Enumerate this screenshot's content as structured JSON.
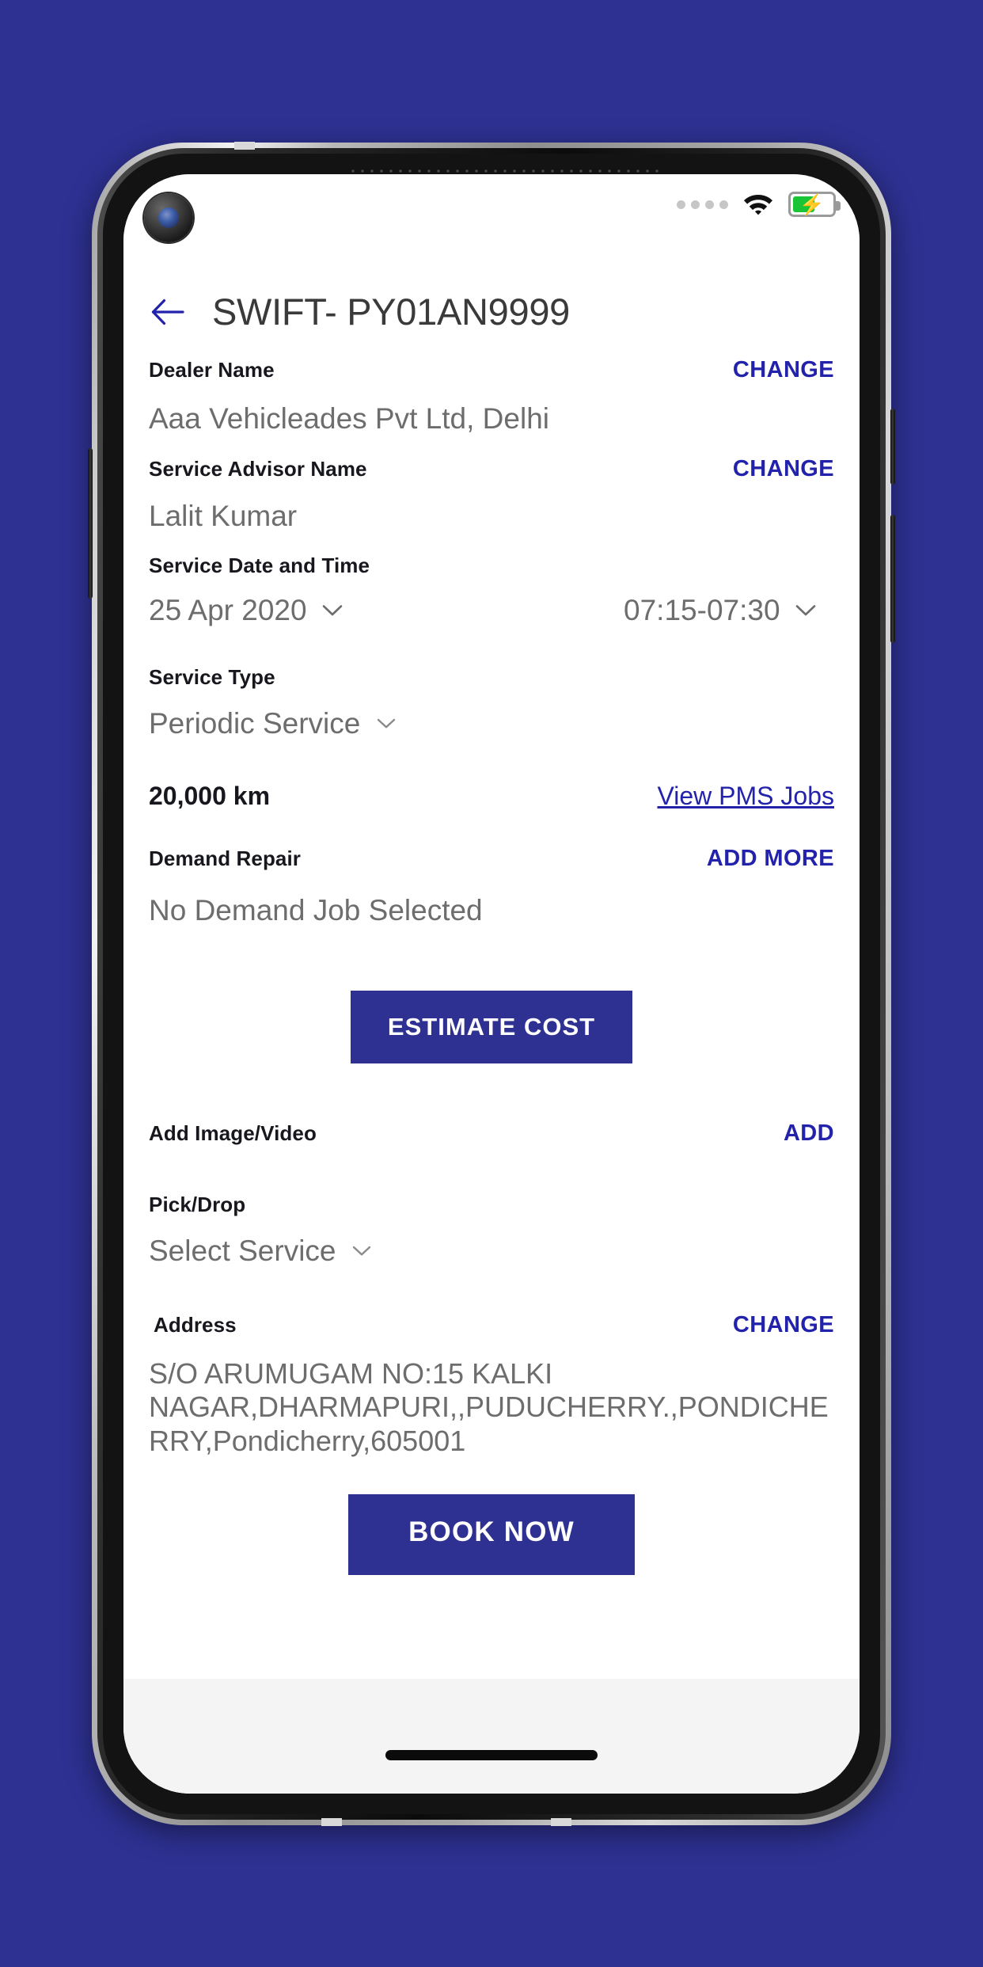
{
  "theme": {
    "page_background": "#2e3192",
    "accent": "#2e3192",
    "link_blue": "#2222aa",
    "label_dark": "#17171e",
    "value_gray": "#6d6d6d",
    "battery_green": "#19c437"
  },
  "status_bar": {
    "signal_icon": "signal-dots-icon",
    "signal_dots": 4,
    "wifi_icon": "wifi-icon",
    "battery_icon": "battery-charging-icon",
    "battery_level_percent": 50,
    "charging": true
  },
  "header": {
    "back_icon": "back-arrow-icon",
    "title": "SWIFT- PY01AN9999"
  },
  "form": {
    "dealer": {
      "label": "Dealer Name",
      "action": "CHANGE",
      "value": "Aaa Vehicleades Pvt Ltd, Delhi"
    },
    "advisor": {
      "label": "Service Advisor Name",
      "action": "CHANGE",
      "value": "Lalit Kumar"
    },
    "service_datetime": {
      "label": "Service Date and Time",
      "date_value": "25 Apr 2020",
      "time_value": "07:15-07:30",
      "date_chevron_icon": "chevron-down-icon",
      "time_chevron_icon": "chevron-down-icon"
    },
    "service_type": {
      "label": "Service Type",
      "value": "Periodic Service",
      "chevron_icon": "chevron-down-icon"
    },
    "mileage": {
      "value": "20,000 km",
      "link": "View PMS Jobs"
    },
    "demand_repair": {
      "label": "Demand Repair",
      "action": "ADD MORE",
      "value": "No Demand Job Selected"
    },
    "estimate_button": "ESTIMATE COST",
    "add_media": {
      "label": "Add Image/Video",
      "action": "ADD"
    },
    "pick_drop": {
      "label": "Pick/Drop",
      "value": "Select Service",
      "chevron_icon": "chevron-down-icon"
    },
    "address": {
      "label": "Address",
      "action": "CHANGE",
      "value": "S/O ARUMUGAM NO:15 KALKI NAGAR,DHARMAPURI,,PUDUCHERRY.,PONDICHERRY,Pondicherry,605001"
    },
    "book_button": "BOOK NOW"
  },
  "system_nav": {
    "home_indicator_icon": "home-indicator-pill"
  }
}
